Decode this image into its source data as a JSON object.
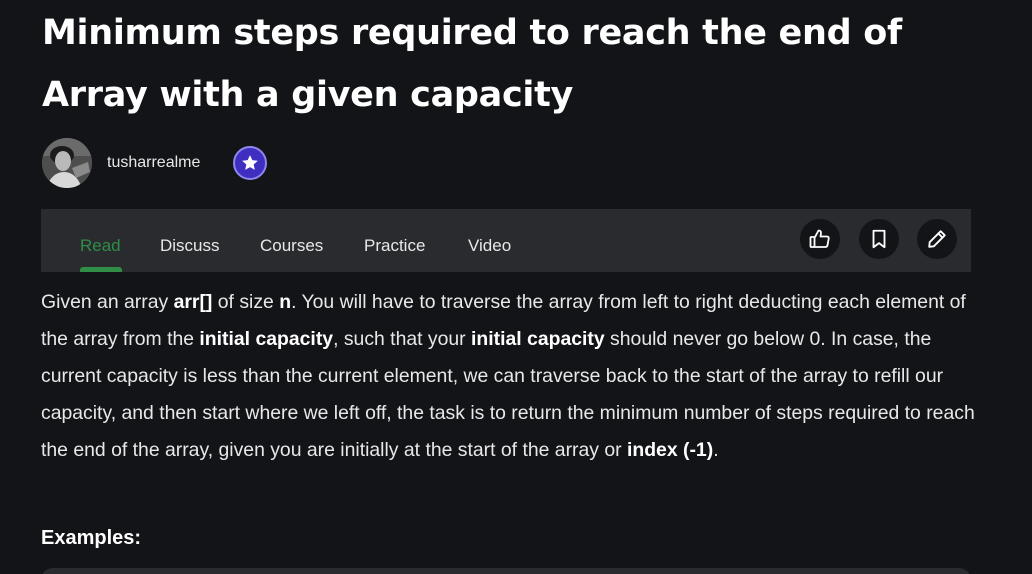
{
  "article": {
    "title": "Minimum steps required to reach the end of Array with a given capacity"
  },
  "author": {
    "name": "tusharrealme"
  },
  "nav": {
    "tabs": [
      {
        "label": "Read"
      },
      {
        "label": "Discuss"
      },
      {
        "label": "Courses"
      },
      {
        "label": "Practice"
      },
      {
        "label": "Video"
      }
    ],
    "active_tab": "Read"
  },
  "icons": {
    "badge": "star-icon",
    "like": "thumbs-up-icon",
    "bookmark": "bookmark-icon",
    "edit": "pencil-icon"
  },
  "body": {
    "p1": "Given an array ",
    "b1": "arr[]",
    "p2": " of size ",
    "b2": "n",
    "p3": ". You will have to traverse the array from left to right deducting each element of the array from the ",
    "b3": "initial capacity",
    "p4": ", such that your ",
    "b4": "initial capacity",
    "p5": " should never go below 0. In case, the current capacity is less than the current element, we can traverse back to the start of the array to refill our capacity, and then start where we left off, the task is to return the minimum number of steps required to reach the end of the array, given you are initially at the start of the array or ",
    "b5": "index (-1)",
    "p6": "."
  },
  "examples_heading": "Examples:",
  "colors": {
    "background": "#131417",
    "panel": "#2a2b2e",
    "accent_green": "#2f8d46",
    "badge_purple": "#3f2fc0"
  }
}
